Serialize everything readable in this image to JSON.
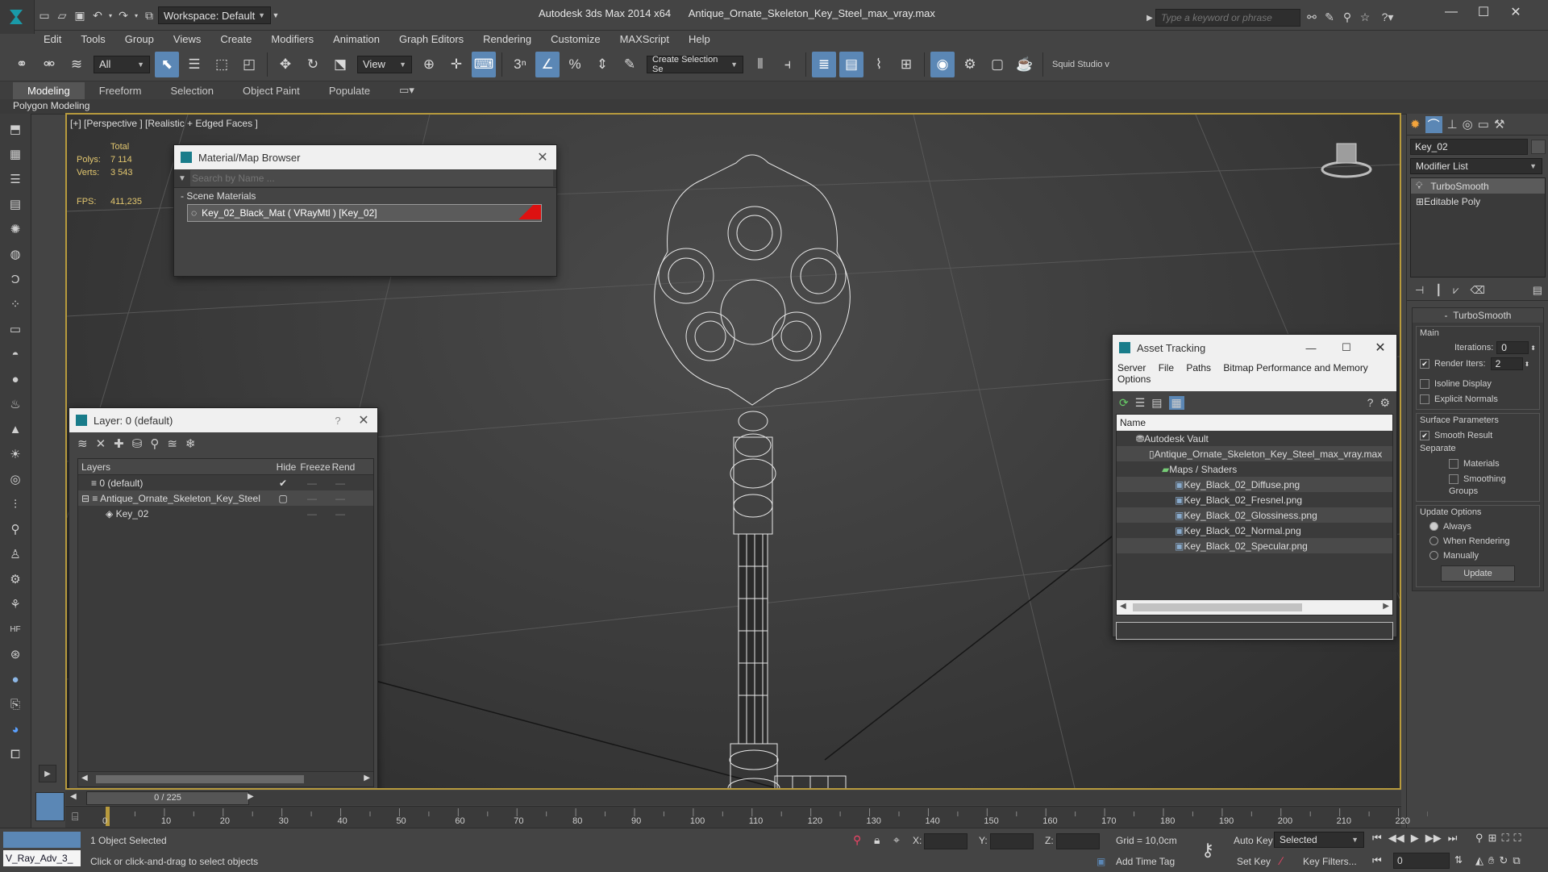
{
  "app": {
    "title": "Autodesk 3ds Max  2014 x64",
    "file": "Antique_Ornate_Skeleton_Key_Steel_max_vray.max",
    "workspace": "Workspace: Default",
    "search_placeholder": "Type a keyword or phrase"
  },
  "menu": [
    "Edit",
    "Tools",
    "Group",
    "Views",
    "Create",
    "Modifiers",
    "Animation",
    "Graph Editors",
    "Rendering",
    "Customize",
    "MAXScript",
    "Help"
  ],
  "toolbar": {
    "filter": "All",
    "ref_coord": "View",
    "selection_set": "Create Selection Se",
    "squid": "Squid Studio v"
  },
  "ribbon": {
    "tabs": [
      "Modeling",
      "Freeform",
      "Selection",
      "Object Paint",
      "Populate"
    ],
    "panel_label": "Polygon Modeling"
  },
  "viewport": {
    "label": "[+] [Perspective ] [Realistic + Edged Faces ]",
    "stats": {
      "total_label": "Total",
      "polys_label": "Polys:",
      "polys": "7 114",
      "verts_label": "Verts:",
      "verts": "3 543",
      "fps_label": "FPS:",
      "fps": "411,235"
    }
  },
  "material_browser": {
    "title": "Material/Map Browser",
    "search": "Search by Name ...",
    "section": "Scene Materials",
    "item": "Key_02_Black_Mat  ( VRayMtl ) [Key_02]"
  },
  "layer_manager": {
    "title": "Layer: 0 (default)",
    "help": "?",
    "columns": [
      "Layers",
      "Hide",
      "Freeze",
      "Rend"
    ],
    "rows": [
      {
        "name": "0 (default)",
        "indent": 0
      },
      {
        "name": "Antique_Ornate_Skeleton_Key_Steel",
        "indent": 0
      },
      {
        "name": "Key_02",
        "indent": 1
      }
    ]
  },
  "asset_tracking": {
    "title": "Asset Tracking",
    "menu": [
      "Server",
      "File",
      "Paths",
      "Bitmap Performance and Memory",
      "Options"
    ],
    "column": "Name",
    "rows": [
      {
        "name": "Autodesk Vault",
        "indent": 1
      },
      {
        "name": "Antique_Ornate_Skeleton_Key_Steel_max_vray.max",
        "indent": 2
      },
      {
        "name": "Maps / Shaders",
        "indent": 3
      },
      {
        "name": "Key_Black_02_Diffuse.png",
        "indent": 4
      },
      {
        "name": "Key_Black_02_Fresnel.png",
        "indent": 4
      },
      {
        "name": "Key_Black_02_Glossiness.png",
        "indent": 4
      },
      {
        "name": "Key_Black_02_Normal.png",
        "indent": 4
      },
      {
        "name": "Key_Black_02_Specular.png",
        "indent": 4
      }
    ]
  },
  "command_panel": {
    "object_name": "Key_02",
    "modifier_list": "Modifier List",
    "stack": [
      "TurboSmooth",
      "Editable Poly"
    ],
    "rollout_title": "TurboSmooth",
    "main_label": "Main",
    "iterations_label": "Iterations:",
    "iterations": "0",
    "render_iters_label": "Render Iters:",
    "render_iters": "2",
    "isoline": "Isoline Display",
    "explicit_normals": "Explicit Normals",
    "surface_params": "Surface Parameters",
    "smooth_result": "Smooth Result",
    "separate": "Separate",
    "materials": "Materials",
    "smoothing_groups": "Smoothing Groups",
    "update_options": "Update Options",
    "always": "Always",
    "when_rendering": "When Rendering",
    "manually": "Manually",
    "update": "Update"
  },
  "timeline": {
    "frame": "0 / 225",
    "ticks": [
      "0",
      "10",
      "20",
      "30",
      "40",
      "50",
      "60",
      "70",
      "80",
      "90",
      "100",
      "110",
      "120",
      "130",
      "140",
      "150",
      "160",
      "170",
      "180",
      "190",
      "200",
      "210",
      "220"
    ]
  },
  "status": {
    "selected": "1 Object Selected",
    "prompt": "Click or click-and-drag to select objects",
    "script_listener": "V_Ray_Adv_3_",
    "x_label": "X:",
    "y_label": "Y:",
    "z_label": "Z:",
    "grid": "Grid = 10,0cm",
    "add_time_tag": "Add Time Tag",
    "auto_key": "Auto Key",
    "auto_key_value": "Selected",
    "set_key": "Set Key",
    "key_filters": "Key Filters...",
    "frame_value": "0"
  }
}
